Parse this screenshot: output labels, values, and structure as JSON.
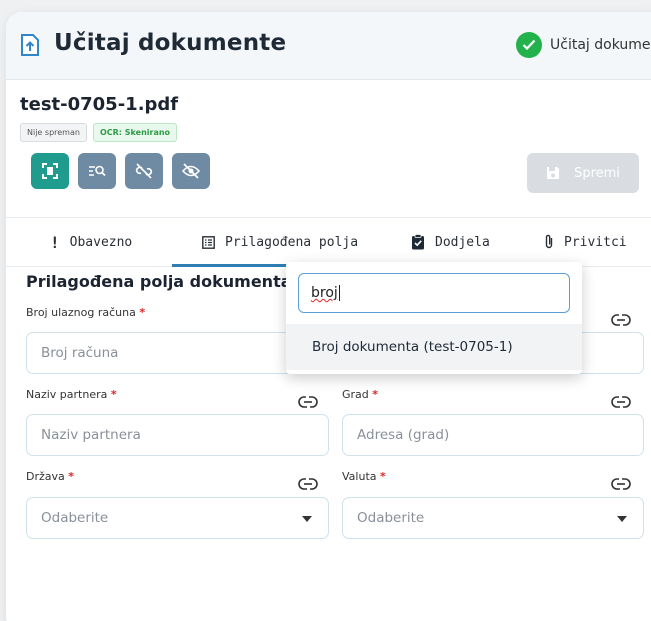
{
  "header": {
    "title": "Učitaj dokumente",
    "status_text": "Učitaj dokume"
  },
  "document": {
    "file_name": "test-0705-1.pdf",
    "badges": [
      "Nije spreman",
      "OCR: Skenirano"
    ],
    "save_label": "Spremi"
  },
  "tabs": [
    {
      "label": "Obavezno",
      "icon": "exclamation-icon"
    },
    {
      "label": "Prilagođena polja",
      "icon": "list-icon",
      "active": true
    },
    {
      "label": "Dodjela",
      "icon": "clipboard-check-icon"
    },
    {
      "label": "Privitci",
      "icon": "paperclip-icon"
    }
  ],
  "section": {
    "title": "Prilagođena polja dokumenta"
  },
  "fields": {
    "broj": {
      "label": "Broj ulaznog računa",
      "required": "*",
      "placeholder": "Broj računa"
    },
    "partner": {
      "label": "Naziv partnera",
      "required": "*",
      "placeholder": "Naziv partnera"
    },
    "grad": {
      "label": "Grad",
      "required": "*",
      "placeholder": "Adresa (grad)"
    },
    "drzava": {
      "label": "Država",
      "required": "*",
      "placeholder": "Odaberite"
    },
    "valuta": {
      "label": "Valuta",
      "required": "*",
      "placeholder": "Odaberite"
    }
  },
  "dropdown": {
    "search_value": "broj",
    "option": "Broj dokumenta (test-0705-1)"
  },
  "colors": {
    "accent": "#2f7fb5",
    "teal": "#1f9c8e",
    "success": "#22b24c",
    "required": "#e02424"
  }
}
